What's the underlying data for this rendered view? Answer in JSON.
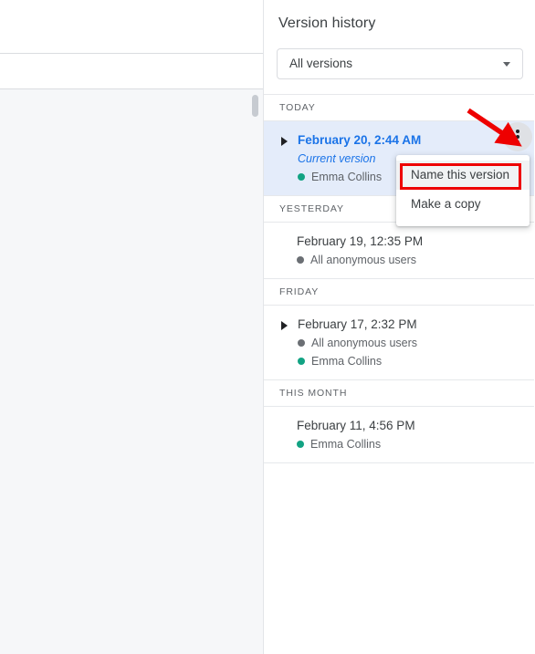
{
  "panel": {
    "title": "Version history",
    "filter": {
      "selected": "All versions",
      "caret_icon": "chevron-down-icon"
    }
  },
  "groups": [
    {
      "label": "TODAY",
      "versions": [
        {
          "date": "February 20, 2:44 AM",
          "current_label": "Current version",
          "selected": true,
          "expandable": true,
          "collaborators": [
            {
              "name": "Emma Collins",
              "color": "#12a383"
            }
          ]
        }
      ]
    },
    {
      "label": "YESTERDAY",
      "versions": [
        {
          "date": "February 19, 12:35 PM",
          "current_label": "",
          "selected": false,
          "expandable": false,
          "collaborators": [
            {
              "name": "All anonymous users",
              "color": "#6b6f74"
            }
          ]
        }
      ]
    },
    {
      "label": "FRIDAY",
      "versions": [
        {
          "date": "February 17, 2:32 PM",
          "current_label": "",
          "selected": false,
          "expandable": true,
          "collaborators": [
            {
              "name": "All anonymous users",
              "color": "#6b6f74"
            },
            {
              "name": "Emma Collins",
              "color": "#12a383"
            }
          ]
        }
      ]
    },
    {
      "label": "THIS MONTH",
      "versions": [
        {
          "date": "February 11, 4:56 PM",
          "current_label": "",
          "selected": false,
          "expandable": false,
          "collaborators": [
            {
              "name": "Emma Collins",
              "color": "#12a383"
            }
          ]
        }
      ]
    }
  ],
  "kebab_menu": {
    "button_icon": "more-vert-icon",
    "items": [
      {
        "label": "Name this version",
        "hovered": true
      },
      {
        "label": "Make a copy",
        "hovered": false
      }
    ]
  },
  "annotation": {
    "highlight_color": "#ee0000",
    "arrow_color": "#ee0000",
    "target": "Name this version"
  },
  "colors": {
    "accent_blue": "#1a73e8",
    "selected_row_bg": "#e4ecfa",
    "teal_dot": "#12a383",
    "gray_dot": "#6b6f74"
  }
}
